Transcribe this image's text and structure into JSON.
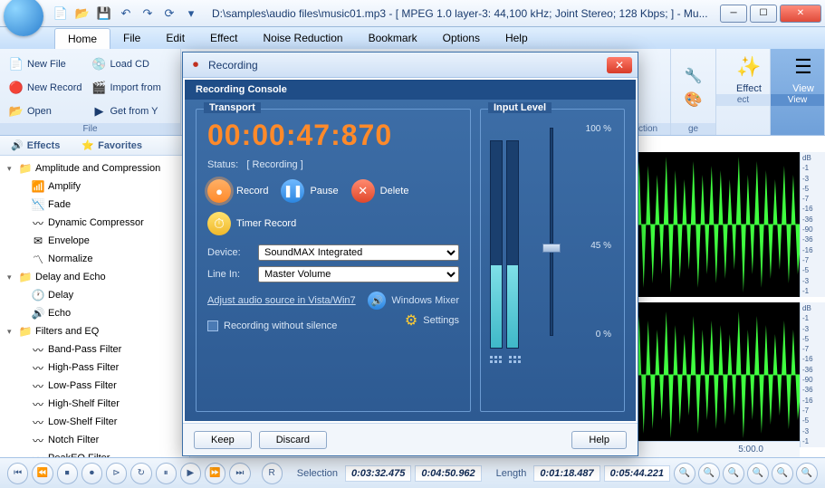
{
  "title_path": "D:\\samples\\audio files\\music01.mp3 - [ MPEG 1.0 layer-3: 44,100 kHz; Joint Stereo; 128 Kbps;  ] - Mu...",
  "menu": {
    "home": "Home",
    "file": "File",
    "edit": "Edit",
    "effect": "Effect",
    "noise": "Noise Reduction",
    "bookmark": "Bookmark",
    "options": "Options",
    "help": "Help"
  },
  "ribbon": {
    "file": {
      "new_file": "New File",
      "new_record": "New Record",
      "open": "Open",
      "load_cd": "Load CD",
      "import_from": "Import from",
      "get_from_y": "Get from Y",
      "label": "File"
    },
    "action": {
      "label": "ction"
    },
    "age": {
      "label": "ge"
    },
    "effect": {
      "big": "Effect",
      "label": "ect"
    },
    "view": {
      "big": "View",
      "label": "View"
    }
  },
  "tabs": {
    "effects": "Effects",
    "favorites": "Favorites"
  },
  "tree": {
    "g1": "Amplitude and Compression",
    "g1_items": [
      "Amplify",
      "Fade",
      "Dynamic Compressor",
      "Envelope",
      "Normalize"
    ],
    "g2": "Delay and Echo",
    "g2_items": [
      "Delay",
      "Echo"
    ],
    "g3": "Filters and EQ",
    "g3_items": [
      "Band-Pass Filter",
      "High-Pass Filter",
      "Low-Pass Filter",
      "High-Shelf Filter",
      "Low-Shelf Filter",
      "Notch Filter",
      "PeakEQ Filter"
    ]
  },
  "db_ticks": [
    "dB",
    "-1",
    "-3",
    "-5",
    "-7",
    "-16",
    "-36",
    "-90",
    "-36",
    "-16",
    "-7",
    "-5",
    "-3",
    "-1"
  ],
  "time_tick": "5:00.0",
  "bottom": {
    "selection": "Selection",
    "sel_a": "0:03:32.475",
    "sel_b": "0:04:50.962",
    "length": "Length",
    "len_a": "0:01:18.487",
    "len_b": "0:05:44.221"
  },
  "dialog": {
    "title": "Recording",
    "console_title": "Recording Console",
    "transport_legend": "Transport",
    "inputlevel_legend": "Input Level",
    "timecode": "00:00:47:870",
    "status_label": "Status:",
    "status_value": "[ Recording ]",
    "record": "Record",
    "pause": "Pause",
    "delete": "Delete",
    "timer_record": "Timer Record",
    "device_label": "Device:",
    "device_value": "SoundMAX Integrated",
    "linein_label": "Line In:",
    "linein_value": "Master Volume",
    "adjust_link": "Adjust audio source in Vista/Win7",
    "windows_mixer": "Windows Mixer",
    "rec_without_silence": "Recording without silence",
    "settings": "Settings",
    "pct100": "100 %",
    "pct45": "45 %",
    "pct0": "0 %",
    "meter_fill_pct": 40,
    "keep": "Keep",
    "discard": "Discard",
    "help": "Help"
  }
}
